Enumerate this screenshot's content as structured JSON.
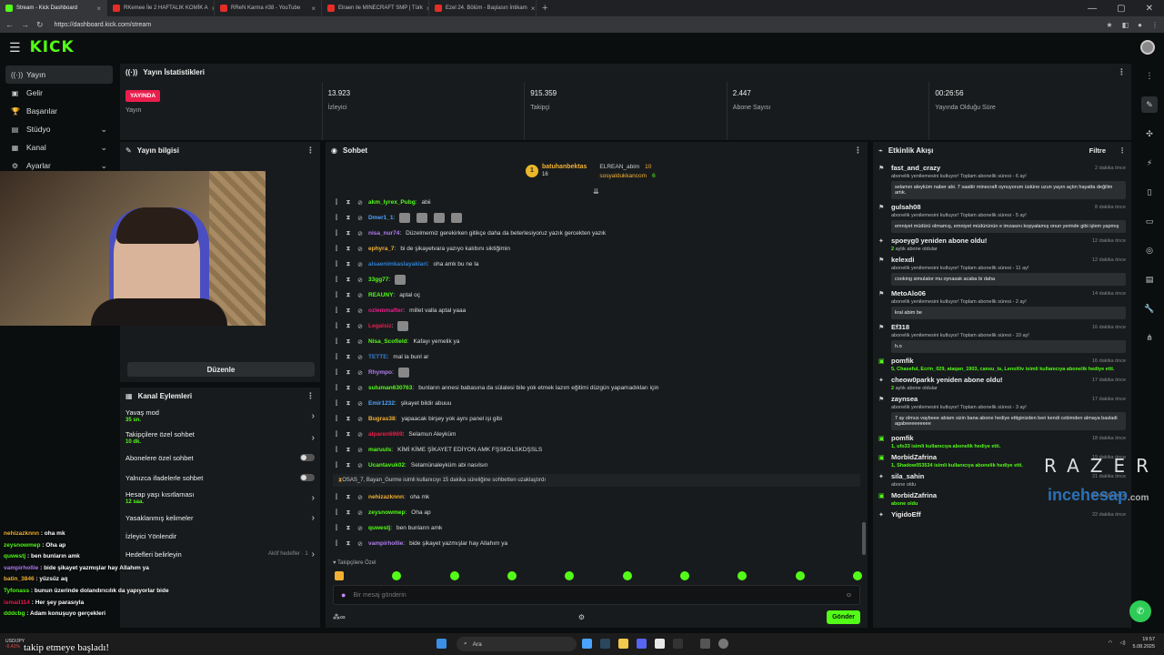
{
  "browser": {
    "tabs": [
      {
        "title": "Stream - Kick Dashboard",
        "color": "#53fc18",
        "active": true
      },
      {
        "title": "RKemee İle 2 HAFTALIK KOMİK A",
        "color": "#e52d27",
        "active": false
      },
      {
        "title": "RReN Karma #38 - YouTube",
        "color": "#e52d27",
        "active": false
      },
      {
        "title": "Elraen ile MINECRAFT SMP | Türk",
        "color": "#e52d27",
        "active": false
      },
      {
        "title": "Ezel 24. Bölüm - Başlasın İntikam",
        "color": "#e52d27",
        "active": false
      }
    ],
    "url": "https://dashboard.kick.com/stream"
  },
  "header": {
    "logo": "KICK"
  },
  "sidebar": {
    "items": [
      {
        "label": "Yayın",
        "icon": "broadcast-icon",
        "glyph": "((·))",
        "active": true,
        "chevron": false
      },
      {
        "label": "Gelir",
        "icon": "money-icon",
        "glyph": "▣",
        "active": false,
        "chevron": false
      },
      {
        "label": "Başarılar",
        "icon": "trophy-icon",
        "glyph": "🏆",
        "active": false,
        "chevron": false
      },
      {
        "label": "Stüdyo",
        "icon": "studio-icon",
        "glyph": "▤",
        "active": false,
        "chevron": true
      },
      {
        "label": "Kanal",
        "icon": "channel-icon",
        "glyph": "▦",
        "active": false,
        "chevron": true
      },
      {
        "label": "Ayarlar",
        "icon": "settings-icon",
        "glyph": "⚙",
        "active": false,
        "chevron": true
      }
    ]
  },
  "stats": {
    "title": "Yayın İstatistikleri",
    "live_badge": "YAYINDA",
    "items": [
      {
        "value": "",
        "label": "Yayın"
      },
      {
        "value": "13.923",
        "label": "İzleyici"
      },
      {
        "value": "915.359",
        "label": "Takipçi"
      },
      {
        "value": "2.447",
        "label": "Abone Sayısı"
      },
      {
        "value": "00:26:56",
        "label": "Yayında Olduğu Süre"
      }
    ]
  },
  "stream_info": {
    "title": "Yayın bilgisi",
    "edit_label": "Düzenle"
  },
  "channel_actions": {
    "title": "Kanal Eylemleri",
    "items": [
      {
        "label": "Yavaş mod",
        "sub": "35 sn.",
        "control": "arrow",
        "hint": ""
      },
      {
        "label": "Takipçilere özel sohbet",
        "sub": "10 dk.",
        "control": "arrow",
        "hint": ""
      },
      {
        "label": "Abonelere özel sohbet",
        "sub": "",
        "control": "toggle",
        "hint": ""
      },
      {
        "label": "Yalnızca ifadelerle sohbet",
        "sub": "",
        "control": "toggle",
        "hint": ""
      },
      {
        "label": "Hesap yaşı kısıtlaması",
        "sub": "12 saa.",
        "control": "arrow",
        "hint": ""
      },
      {
        "label": "Yasaklanmış kelimeler",
        "sub": "",
        "control": "arrow",
        "hint": ""
      },
      {
        "label": "İzleyici Yönlendir",
        "sub": "",
        "control": "none",
        "hint": ""
      },
      {
        "label": "Hedefleri belirleyin",
        "sub": "",
        "control": "arrow",
        "hint": "Aktif hedefler · 1"
      }
    ]
  },
  "chat": {
    "title": "Sohbet",
    "pinned": {
      "top_name": "batuhanbektas",
      "top_count": "16",
      "second_name": "ELREAN_abim",
      "second_count": "10",
      "third_name": "sosyaldukkancom",
      "third_count": "6"
    },
    "messages": [
      {
        "user": "akm_lyrex_Pubg",
        "color": "#53fc18",
        "text": "abii",
        "emotes": 0
      },
      {
        "user": "Dmer1_1",
        "color": "#4aa3ff",
        "text": "",
        "emotes": 4
      },
      {
        "user": "nisa_nur74",
        "color": "#b07cf0",
        "text": "Düzelmemiz gerekirken gitikçe daha da beterlesiyoruz yazık gercekten yazık",
        "emotes": 0
      },
      {
        "user": "ephyra_7",
        "color": "#f2b134",
        "text": "bi de şikayetvara yazıyo kalıbını siktiğimin",
        "emotes": 0
      },
      {
        "user": "alsaenimkaslayaklari",
        "color": "#2f7fd1",
        "text": "oha amk bu ne la",
        "emotes": 0
      },
      {
        "user": "33gg77",
        "color": "#53fc18",
        "text": "",
        "emotes": 1
      },
      {
        "user": "REAUNY",
        "color": "#53fc18",
        "text": "aptal oç",
        "emotes": 0
      },
      {
        "user": "ozlemmafter",
        "color": "#e91e8c",
        "text": "millet valla aptal yaaa",
        "emotes": 0
      },
      {
        "user": "Legalsiz",
        "color": "#e91e4d",
        "text": "",
        "emotes": 1
      },
      {
        "user": "Nisa_Scofield",
        "color": "#53fc18",
        "text": "Kafayı yemelik ya",
        "emotes": 0
      },
      {
        "user": "TETTE",
        "color": "#2f7fd1",
        "text": "mal la bunl ar",
        "emotes": 0
      },
      {
        "user": "Rhympo",
        "color": "#b07cf0",
        "text": "",
        "emotes": 1
      },
      {
        "user": "suluman630763",
        "color": "#53fc18",
        "text": "bunların annesi babasına da sülalesi bile yok etmek lazım eğitimi düzgün yapamadıkları için",
        "emotes": 0
      },
      {
        "user": "Emir1232",
        "color": "#4aa3ff",
        "text": "şikayet bildir abuuu",
        "emotes": 0
      },
      {
        "user": "Bugras38",
        "color": "#f2b134",
        "text": "yapaacak birşey yok aynı panel işi gibi",
        "emotes": 0
      },
      {
        "user": "alparen6969",
        "color": "#e91e4d",
        "text": "Selamun Aleyküm",
        "emotes": 0
      },
      {
        "user": "maruuls",
        "color": "#53fc18",
        "text": "KİMİ KİME ŞİKAYET EDİYON AMK FŞSKDLSKDŞSLS",
        "emotes": 0
      },
      {
        "user": "Ucantavuk02",
        "color": "#53fc18",
        "text": "Selamünaleyküm abi nasılsın",
        "emotes": 0
      }
    ],
    "system_notice": "OSAS_7, Bayan_Gurme isimli kullanıcıyı 15 dakika süreliğine sohbetten uzaklaştırdı",
    "messages_after": [
      {
        "user": "nehizazknnn",
        "color": "#f2b134",
        "text": "oha mk",
        "emotes": 0
      },
      {
        "user": "zeysnowmep",
        "color": "#53fc18",
        "text": "Oha ap",
        "emotes": 0
      },
      {
        "user": "quwestj",
        "color": "#53fc18",
        "text": "ben bunların amk",
        "emotes": 0
      },
      {
        "user": "vampirhollie",
        "color": "#b07cf0",
        "text": "bide şikayet yazmışlar hay Allahım ya",
        "emotes": 0
      }
    ],
    "subs_label": "Takipçilere Özel",
    "input_placeholder": "Bir mesaj gönderin",
    "send_label": "Gönder"
  },
  "feed": {
    "title": "Etkinlik Akışı",
    "filter_label": "Filtre",
    "events": [
      {
        "user": "fast_and_crazy",
        "time": "2 dakika önce",
        "sub": "abonelik yenilemesini kutluyor! Toplam abonelik süresi - 6 ay!",
        "note": "selamın aleyküm naber abi. 7 saattir minecraft oynuyorum üstüne uzun yayın açtın hayatta değilim artık.",
        "icon": "gift-icon",
        "green": false,
        "sub_green": ""
      },
      {
        "user": "gulsah08",
        "time": "8 dakika önce",
        "sub": "abonelik yenilemesini kutluyor! Toplam abonelik süresi - 5 ay!",
        "note": "emniyet müdürü olmamış, emniyet müdürünün e imzasını kopyalamış onun yerinde gibi işlem yapmış",
        "icon": "gift-icon",
        "green": false,
        "sub_green": ""
      },
      {
        "user": "spoeyg0 yeniden abone oldu!",
        "time": "12 dakika önce",
        "sub": "aylık abone oldular",
        "note": "",
        "icon": "star-icon",
        "green": false,
        "sub_green": "2"
      },
      {
        "user": "kelexdi",
        "time": "12 dakika önce",
        "sub": "abonelik yenilemesini kutluyor! Toplam abonelik süresi - 11 ay!",
        "note": "cooking simulator mu oynasak acaba bi daha",
        "icon": "gift-icon",
        "green": false,
        "sub_green": ""
      },
      {
        "user": "MetoAlo06",
        "time": "14 dakika önce",
        "sub": "abonelik yenilemesini kutluyor! Toplam abonelik süresi - 2 ay!",
        "note": "kral abim be",
        "icon": "gift-icon",
        "green": false,
        "sub_green": ""
      },
      {
        "user": "Ef318",
        "time": "16 dakika önce",
        "sub": "abonelik yenilemesini kutluyor! Toplam abonelik süresi - 10 ay!",
        "note": "h.o",
        "icon": "gift-icon",
        "green": false,
        "sub_green": ""
      },
      {
        "user": "pomfik",
        "time": "16 dakika önce",
        "sub": "5, Chaseful, Ecrin_029, ataqan_1903, cansu_ts, LenoXtv isimli kullanıcıya abonelik hediye etti.",
        "note": "",
        "icon": "gift-box-icon",
        "green": true,
        "sub_green": ""
      },
      {
        "user": "cheow0parkk yeniden abone oldu!",
        "time": "17 dakika önce",
        "sub": "aylık abone oldular",
        "note": "",
        "icon": "star-icon",
        "green": false,
        "sub_green": "2"
      },
      {
        "user": "zaynsea",
        "time": "17 dakika önce",
        "sub": "abonelik yenilemesini kutluyor! Toplam abonelik süresi - 3 ay!",
        "note": "7 ay olmus vaybeee abiam sizin bana abone hediye ettiginizden beri kendi cebimden almaya basladi agabeeeeeeeee",
        "icon": "gift-icon",
        "green": false,
        "sub_green": ""
      },
      {
        "user": "pomfik",
        "time": "18 dakika önce",
        "sub": "1, ufo33 isimli kullanıcıya abonelik hediye etti.",
        "note": "",
        "icon": "gift-box-icon",
        "green": true,
        "sub_green": ""
      },
      {
        "user": "MorbidZafrina",
        "time": "19 dakika önce",
        "sub": "1, Shadow053534 isimli kullanıcıya abonelik hediye etti.",
        "note": "",
        "icon": "gift-box-icon",
        "green": true,
        "sub_green": ""
      },
      {
        "user": "sila_sahin",
        "time": "21 dakika önce",
        "sub": "abone oldu",
        "note": "",
        "icon": "star-icon",
        "green": false,
        "sub_green": ""
      },
      {
        "user": "MorbidZafrina",
        "time": "22 dakika önce",
        "sub": "abone oldu",
        "note": "",
        "icon": "gift-box-icon",
        "green": true,
        "sub_green": ""
      },
      {
        "user": "YigidoEff",
        "time": "22 dakika önce",
        "sub": "",
        "note": "",
        "icon": "star-icon",
        "green": false,
        "sub_green": ""
      }
    ]
  },
  "overlay_chat": [
    {
      "user": "nehizazknnn",
      "color": "#f2b134",
      "text": "oha mk"
    },
    {
      "user": "zeysnowmep",
      "color": "#53fc18",
      "text": "Oha ap"
    },
    {
      "user": "quwestj",
      "color": "#53fc18",
      "text": "ben bunların amk"
    },
    {
      "user": "vampirhollie",
      "color": "#b07cf0",
      "text": "bide şikayet yazmışlar hay Allahım ya"
    },
    {
      "user": "batin_3846",
      "color": "#f2b134",
      "text": "yüzsüz aq"
    },
    {
      "user": "Tyfonass",
      "color": "#53fc18",
      "text": "bunun üzerinde dolandırıcılık da yapıyorlar bide"
    },
    {
      "user": "ismail114",
      "color": "#e91e4d",
      "text": "Her şey parasıyla"
    },
    {
      "user": "dddcbg",
      "color": "#53fc18",
      "text": "Adam konuşuyo gerçekleri"
    }
  ],
  "watermark": {
    "brand": "RAZER",
    "site": "incehesap",
    "tld": ".com"
  },
  "banner": {
    "text": "takip etmeye başladı!"
  },
  "taskbar": {
    "ticker_name": "USD/JPY",
    "ticker_val": "-0,41%",
    "search_placeholder": "Ara",
    "time": "19:57",
    "date": "5.08.2025"
  },
  "colors": {
    "accent": "#53fc18",
    "live": "#e91e4d",
    "panel": "#181b1d",
    "bg": "#0b0e0f"
  }
}
